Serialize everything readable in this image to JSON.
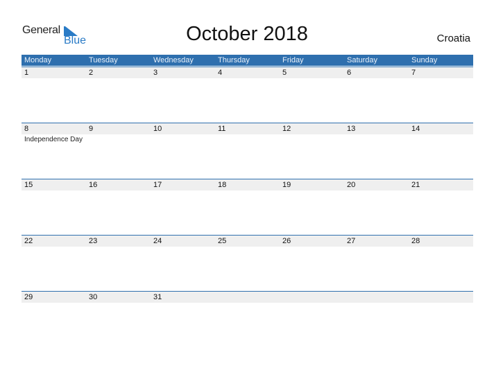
{
  "logo": {
    "line1": "General",
    "line2": "Blue"
  },
  "title": "October 2018",
  "country": "Croatia",
  "colors": {
    "accent": "#2e6fae",
    "strip": "#efefef",
    "logo_blue": "#2a7bc6"
  },
  "weekdays": [
    "Monday",
    "Tuesday",
    "Wednesday",
    "Thursday",
    "Friday",
    "Saturday",
    "Sunday"
  ],
  "weeks": [
    {
      "days": [
        "1",
        "2",
        "3",
        "4",
        "5",
        "6",
        "7"
      ],
      "events": [
        "",
        "",
        "",
        "",
        "",
        "",
        ""
      ]
    },
    {
      "days": [
        "8",
        "9",
        "10",
        "11",
        "12",
        "13",
        "14"
      ],
      "events": [
        "Independence Day",
        "",
        "",
        "",
        "",
        "",
        ""
      ]
    },
    {
      "days": [
        "15",
        "16",
        "17",
        "18",
        "19",
        "20",
        "21"
      ],
      "events": [
        "",
        "",
        "",
        "",
        "",
        "",
        ""
      ]
    },
    {
      "days": [
        "22",
        "23",
        "24",
        "25",
        "26",
        "27",
        "28"
      ],
      "events": [
        "",
        "",
        "",
        "",
        "",
        "",
        ""
      ]
    },
    {
      "days": [
        "29",
        "30",
        "31",
        "",
        "",
        "",
        ""
      ],
      "events": [
        "",
        "",
        "",
        "",
        "",
        "",
        ""
      ]
    }
  ]
}
